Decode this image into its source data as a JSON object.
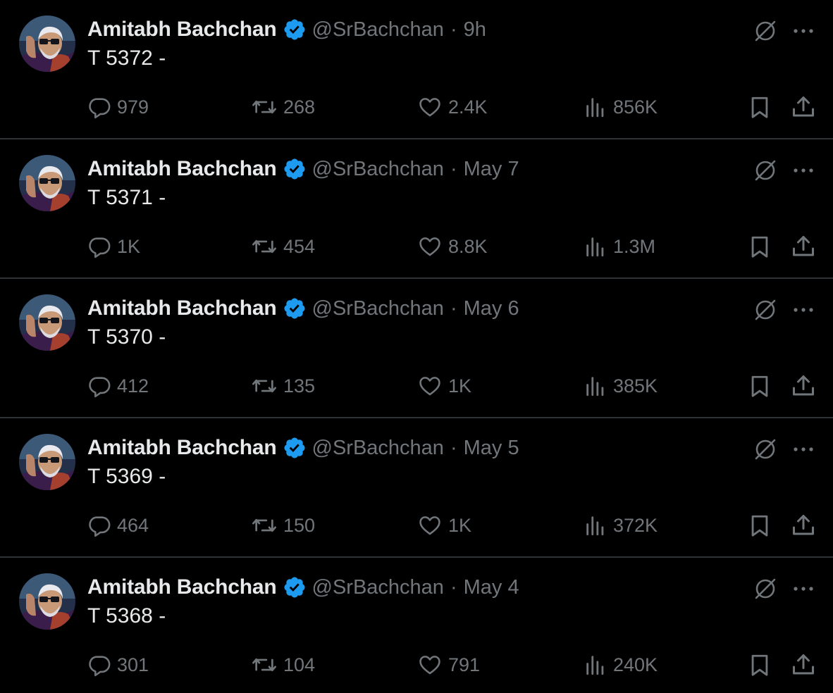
{
  "colors": {
    "background": "#000000",
    "primary_text": "#e7e9ea",
    "secondary_text": "#71767b",
    "divider": "#2f3336",
    "verified_badge": "#1d9bf0"
  },
  "icons": {
    "reply": "reply-bubble-icon",
    "repost": "repost-arrows-icon",
    "like": "heart-icon",
    "views": "analytics-bars-icon",
    "bookmark": "bookmark-icon",
    "share": "share-upload-icon",
    "grok": "grok-slash-circle-icon",
    "more": "ellipsis-icon",
    "verified": "verified-badge-icon"
  },
  "tweets": [
    {
      "author_name": "Amitabh Bachchan",
      "handle": "@SrBachchan",
      "separator": "·",
      "time": "9h",
      "text": "T 5372 -",
      "replies": "979",
      "reposts": "268",
      "likes": "2.4K",
      "views": "856K"
    },
    {
      "author_name": "Amitabh Bachchan",
      "handle": "@SrBachchan",
      "separator": "·",
      "time": "May 7",
      "text": "T 5371 -",
      "replies": "1K",
      "reposts": "454",
      "likes": "8.8K",
      "views": "1.3M"
    },
    {
      "author_name": "Amitabh Bachchan",
      "handle": "@SrBachchan",
      "separator": "·",
      "time": "May 6",
      "text": "T 5370 -",
      "replies": "412",
      "reposts": "135",
      "likes": "1K",
      "views": "385K"
    },
    {
      "author_name": "Amitabh Bachchan",
      "handle": "@SrBachchan",
      "separator": "·",
      "time": "May 5",
      "text": "T 5369 -",
      "replies": "464",
      "reposts": "150",
      "likes": "1K",
      "views": "372K"
    },
    {
      "author_name": "Amitabh Bachchan",
      "handle": "@SrBachchan",
      "separator": "·",
      "time": "May 4",
      "text": "T 5368 -",
      "replies": "301",
      "reposts": "104",
      "likes": "791",
      "views": "240K"
    }
  ]
}
